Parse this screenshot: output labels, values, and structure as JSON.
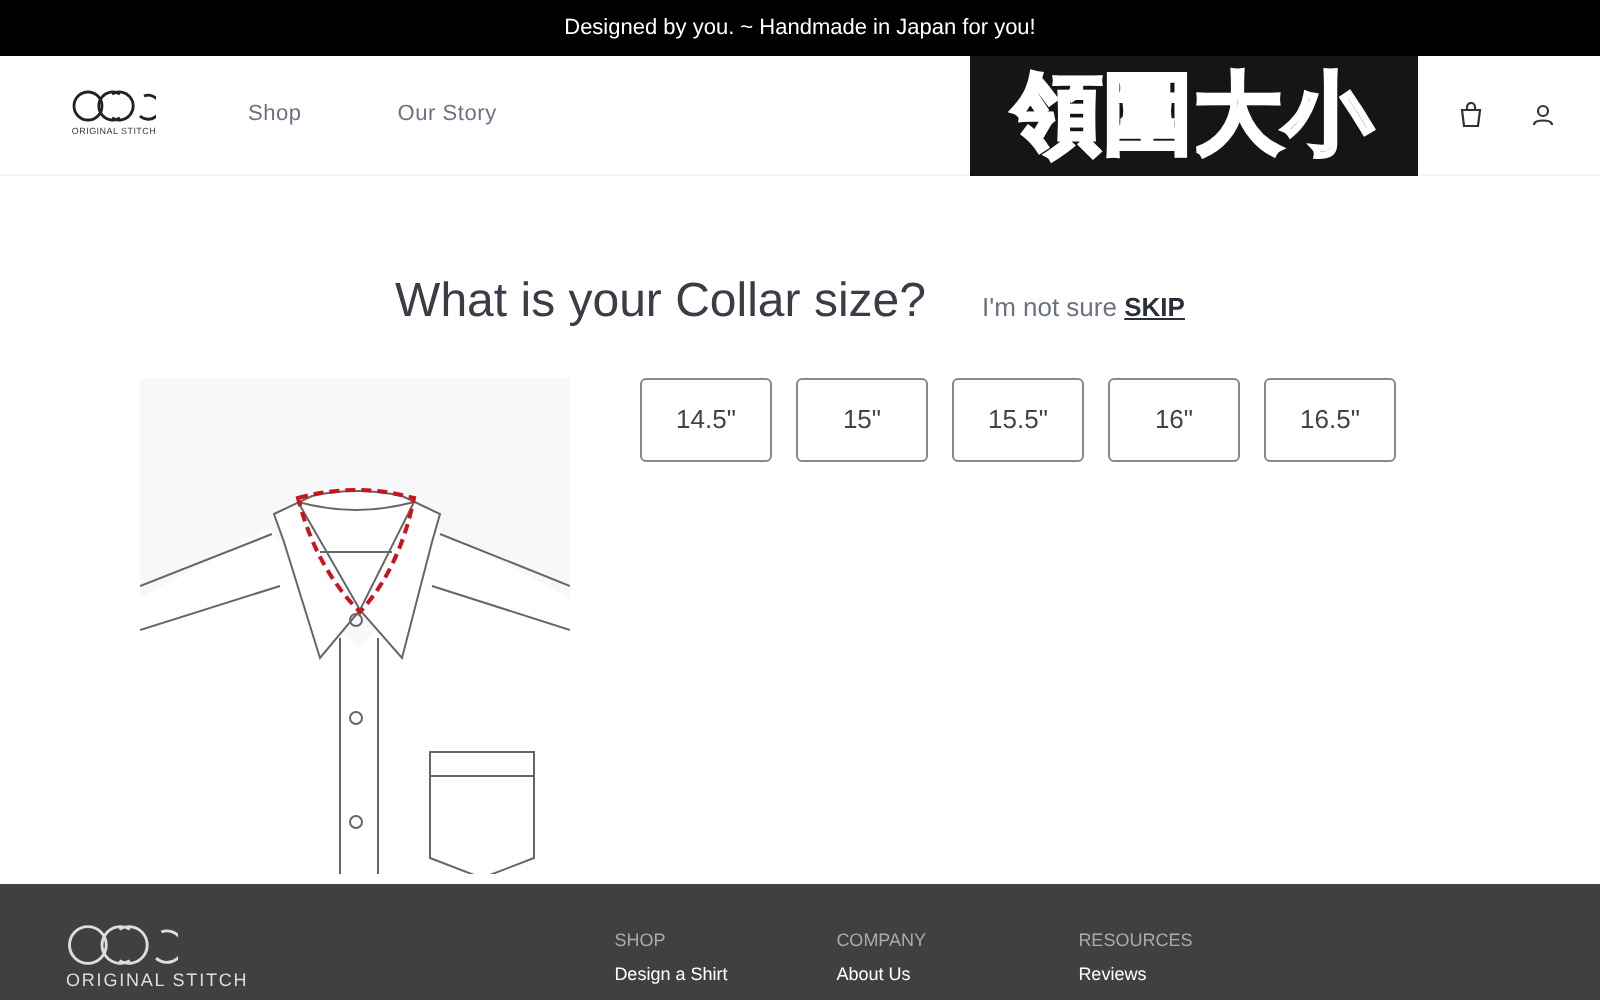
{
  "announcement": "Designed by you. ~ Handmade in Japan for you!",
  "header": {
    "logo_text": "ORIGINAL STITCH",
    "nav": [
      "Shop",
      "Our Story"
    ],
    "annotation_caption": "領圍大小"
  },
  "question": {
    "title": "What is your Collar size?",
    "hint": "I'm not sure",
    "skip": "SKIP"
  },
  "sizes": [
    {
      "label": "14.5\"",
      "selected": false
    },
    {
      "label": "15\"",
      "selected": false
    },
    {
      "label": "15.5\"",
      "selected": false
    },
    {
      "label": "16\"",
      "selected": false
    },
    {
      "label": "16.5\"",
      "selected": false
    }
  ],
  "footer": {
    "logo_text": "ORIGINAL STITCH",
    "columns": [
      {
        "heading": "SHOP",
        "link": "Design a Shirt"
      },
      {
        "heading": "COMPANY",
        "link": "About Us"
      },
      {
        "heading": "RESOURCES",
        "link": "Reviews"
      }
    ]
  }
}
